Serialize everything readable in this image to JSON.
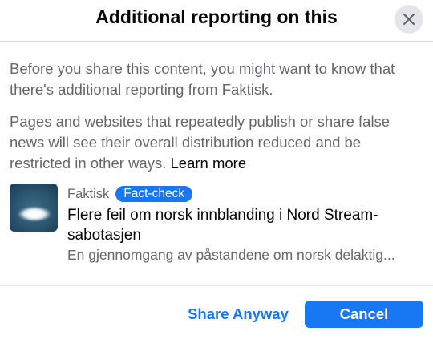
{
  "dialog": {
    "title": "Additional reporting on this",
    "close_icon": "close-icon"
  },
  "body": {
    "paragraph1": "Before you share this content, you might want to know that there's additional reporting from Faktisk.",
    "paragraph2": "Pages and websites that repeatedly publish or share false news will see their overall distribution reduced and be restricted in other ways.",
    "learn_more": "Learn more"
  },
  "article": {
    "source": "Faktisk",
    "badge": "Fact-check",
    "headline": "Flere feil om norsk innblanding i Nord Stream-sabotasjen",
    "subtitle": "En gjennomgang av påstandene om norsk delaktig..."
  },
  "footer": {
    "share_anyway": "Share Anyway",
    "cancel": "Cancel"
  },
  "colors": {
    "accent": "#1877f2",
    "secondary_text": "#65676b",
    "primary_text": "#050505"
  }
}
